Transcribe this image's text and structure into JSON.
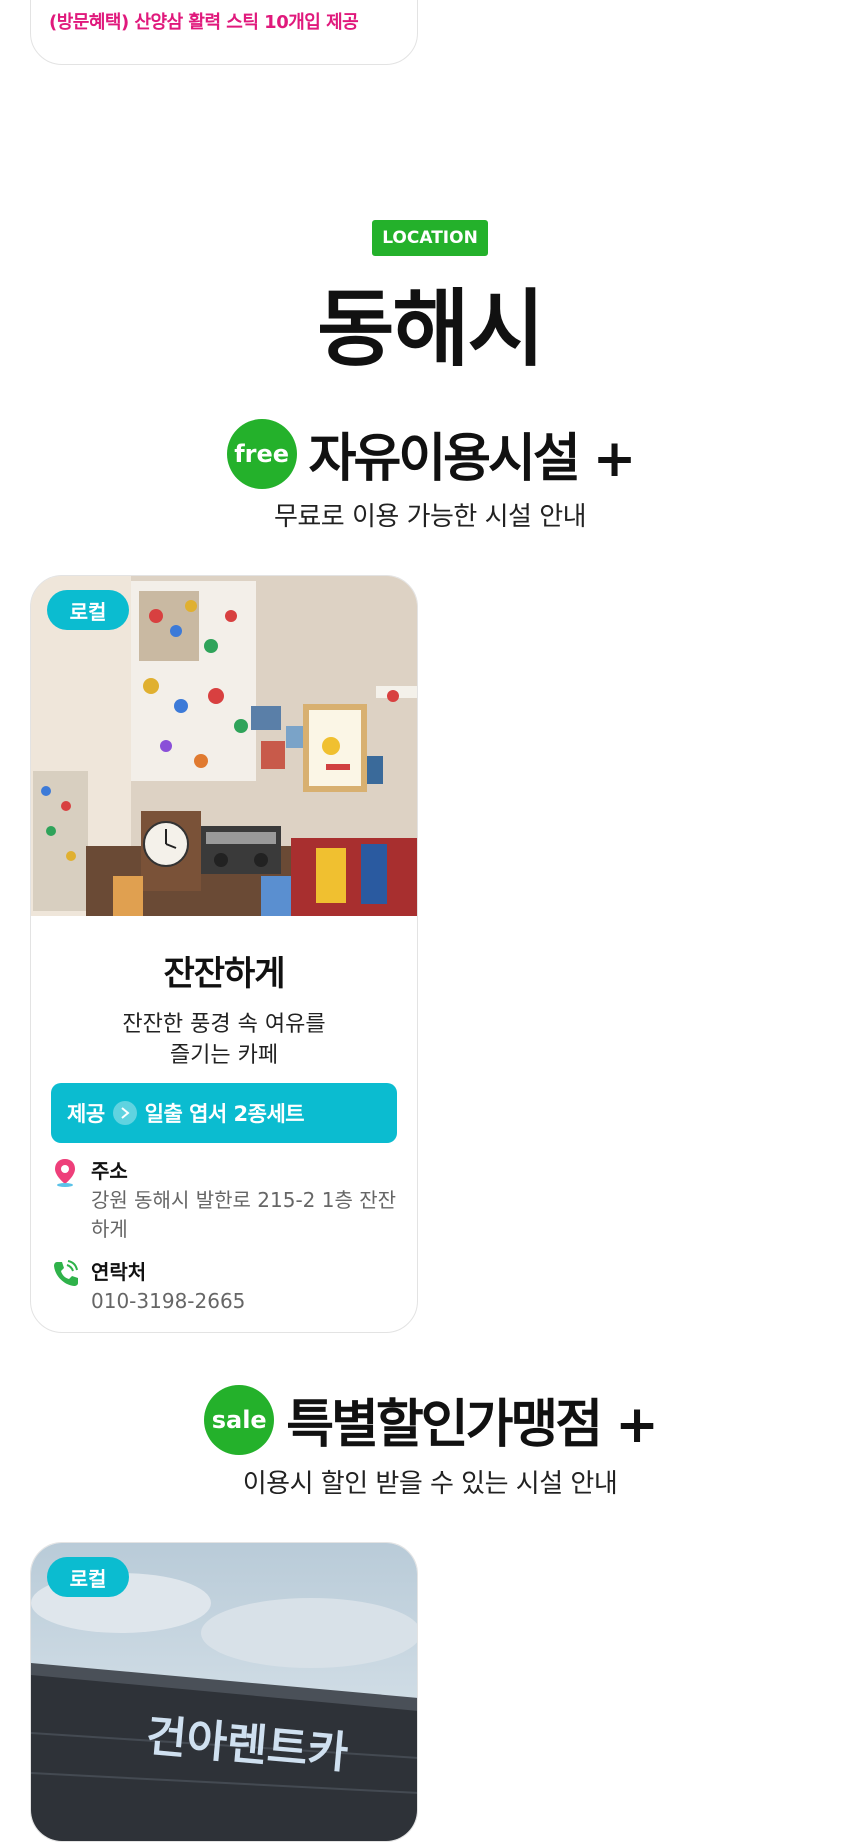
{
  "top_card": {
    "benefit": "(방문혜택) 산양삼 활력 스틱 10개입 제공"
  },
  "location_badge": "LOCATION",
  "city": "동해시",
  "free_section": {
    "badge": "free",
    "title": "자유이용시설 +",
    "subtitle": "무료로 이용 가능한 시설 안내"
  },
  "free_card": {
    "tag": "로컬",
    "name": "잔잔하게",
    "description": "잔잔한 풍경 속 여유를\n즐기는 카페",
    "provide_label": "제공",
    "provide_item": "일출 엽서 2종세트",
    "address_label": "주소",
    "address_value": "강원 동해시 발한로 215-2 1층 잔잔하게",
    "contact_label": "연락처",
    "contact_value": "010-3198-2665"
  },
  "sale_section": {
    "badge": "sale",
    "title": "특별할인가맹점 +",
    "subtitle": "이용시 할인 받을 수 있는 시설 안내"
  },
  "sale_card": {
    "tag": "로컬",
    "sign_text": "건아렌트카"
  },
  "colors": {
    "green": "#24b12b",
    "cyan": "#0bbcd0",
    "pink": "#e0197c"
  }
}
